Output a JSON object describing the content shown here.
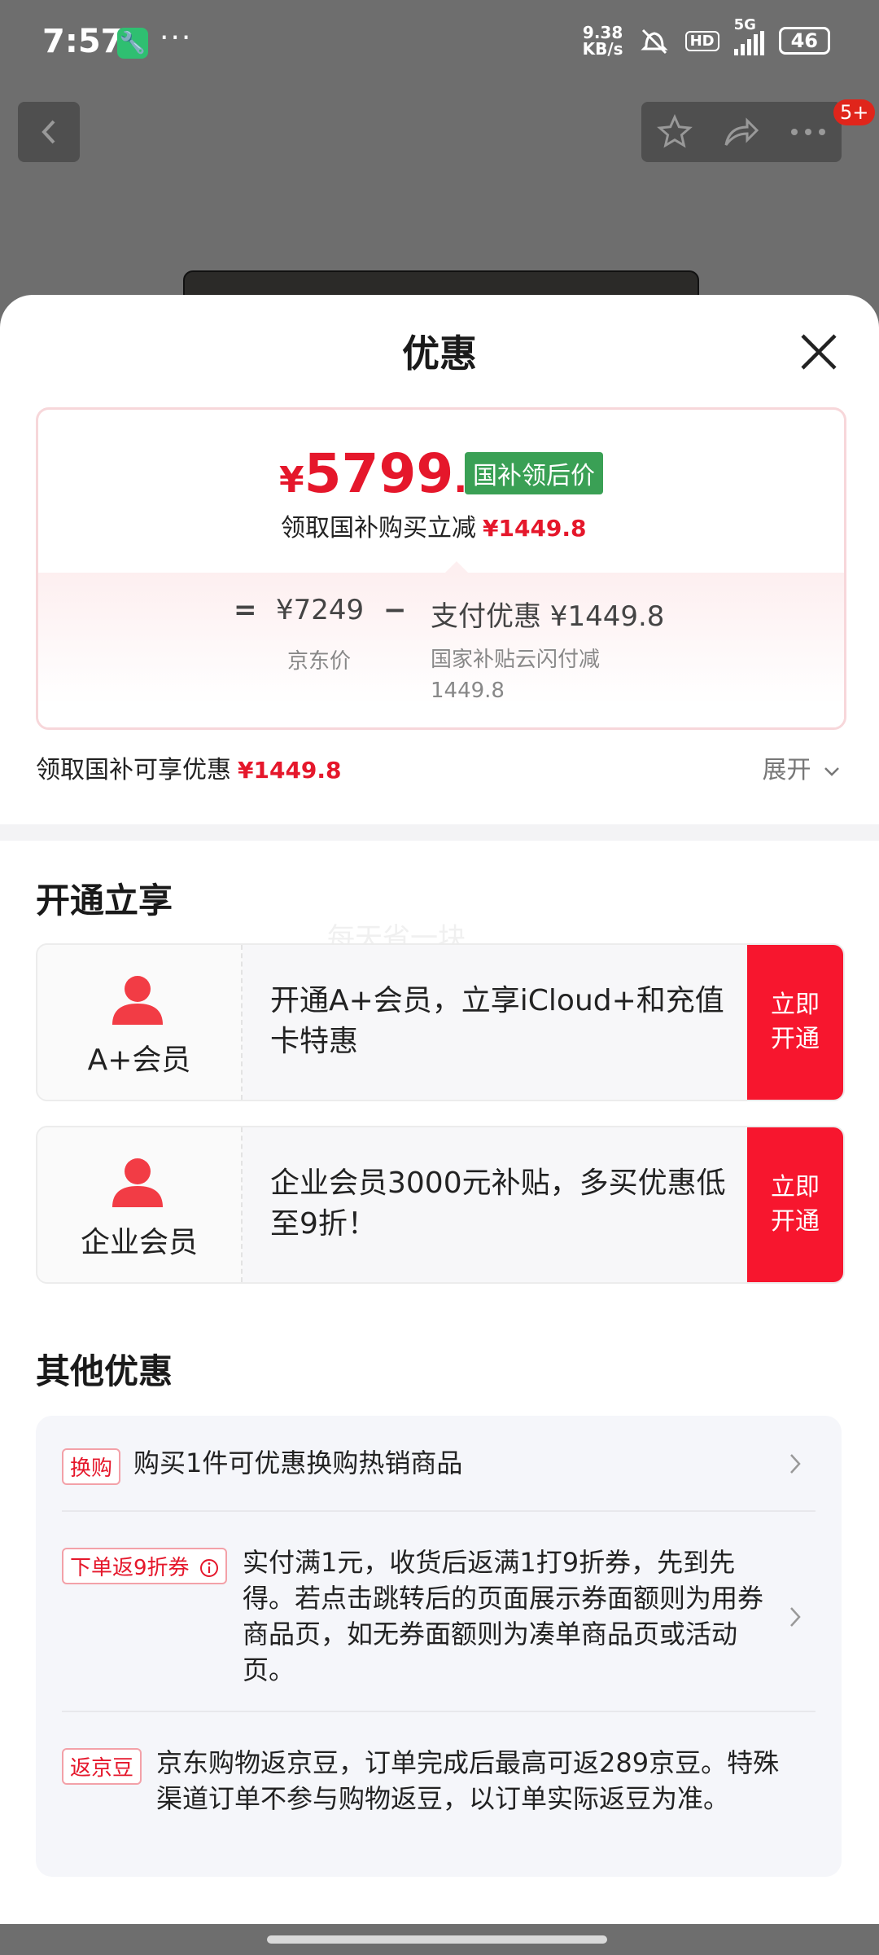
{
  "status_bar": {
    "time": "7:57",
    "app_icon": "wrench-icon",
    "overflow": "···",
    "speed_value": "9.38",
    "speed_unit": "KB/s",
    "hd": "HD",
    "network": "5G",
    "battery": "46"
  },
  "nav": {
    "back_icon": "chevron-left-icon",
    "favorite_icon": "star-icon",
    "share_icon": "share-icon",
    "more_icon": "more-icon",
    "badge": "5+"
  },
  "sheet": {
    "title": "优惠",
    "close_icon": "close-icon"
  },
  "price_card": {
    "price_yen": "¥",
    "price_int": "5799",
    "price_dec": ".2",
    "tag": "国补领后价",
    "claim_text": "领取国补购买立减",
    "claim_amount": "¥1449.8",
    "equals": "=",
    "jd_price": "¥7249",
    "jd_label": "京东价",
    "minus": "−",
    "pay_discount": "支付优惠 ¥1449.8",
    "pay_discount_desc": "国家补贴云闪付减1449.8"
  },
  "discount_summary": {
    "text": "领取国补可享优惠",
    "amount": "¥1449.8",
    "expand_label": "展开"
  },
  "membership": {
    "title": "开通立享",
    "watermark": "每天省一块",
    "cards": [
      {
        "name": "A+会员",
        "desc": "开通A+会员，立享iCloud+和充值卡特惠",
        "button_line1": "立即",
        "button_line2": "开通"
      },
      {
        "name": "企业会员",
        "desc": "企业会员3000元补贴，多买优惠低至9折！",
        "button_line1": "立即",
        "button_line2": "开通"
      }
    ]
  },
  "other": {
    "title": "其他优惠",
    "items": [
      {
        "tag": "换购",
        "text": "购买1件可优惠换购热销商品"
      },
      {
        "tag": "下单返9折券",
        "info_icon": "info-icon",
        "text": "实付满1元，收货后返满1打9折券，先到先得。若点击跳转后的页面展示券面额则为用券商品页，如无券面额则为凑单商品页或活动页。"
      },
      {
        "tag": "返京豆",
        "text": "京东购物返京豆，订单完成后最高可返289京豆。特殊渠道订单不参与购物返豆，以订单实际返豆为准。"
      }
    ]
  },
  "colors": {
    "accent_red": "#e5172b",
    "button_red": "#f7162e",
    "tag_green": "#3aa055"
  }
}
